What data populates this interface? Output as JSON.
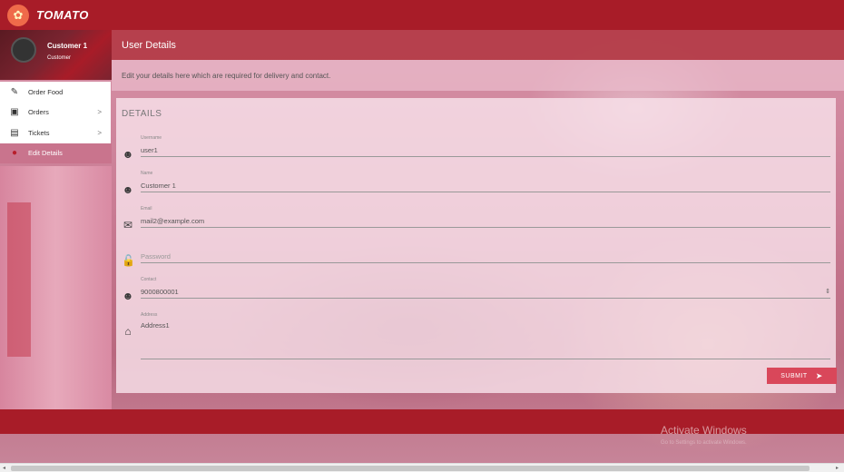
{
  "app": {
    "brand": "TOMATO"
  },
  "profile": {
    "name": "Customer 1",
    "role": "Customer"
  },
  "sidebar": {
    "items": [
      {
        "label": "Order Food",
        "icon": "pencil-icon",
        "chevron": ""
      },
      {
        "label": "Orders",
        "icon": "calendar-icon",
        "chevron": ">"
      },
      {
        "label": "Tickets",
        "icon": "chat-icon",
        "chevron": ">"
      },
      {
        "label": "Edit Details",
        "icon": "person-icon",
        "chevron": ""
      }
    ]
  },
  "main": {
    "title": "User Details",
    "subtitle": "Edit your details here which are required for delivery and contact.",
    "card_title": "DETAILS"
  },
  "form": {
    "username": {
      "label": "Username",
      "value": "user1"
    },
    "name": {
      "label": "Name",
      "value": "Customer 1"
    },
    "email": {
      "label": "Email",
      "value": "mail2@example.com"
    },
    "password": {
      "label": "",
      "placeholder": "Password"
    },
    "contact": {
      "label": "Contact",
      "value": "9000800001"
    },
    "address": {
      "label": "Address",
      "value": "Address1"
    },
    "submit_label": "SUBMIT"
  },
  "watermark": {
    "line1": "Activate Windows",
    "line2": "Go to Settings to activate Windows."
  },
  "colors": {
    "brand_red": "#a81c28",
    "accent": "#d9475a"
  }
}
